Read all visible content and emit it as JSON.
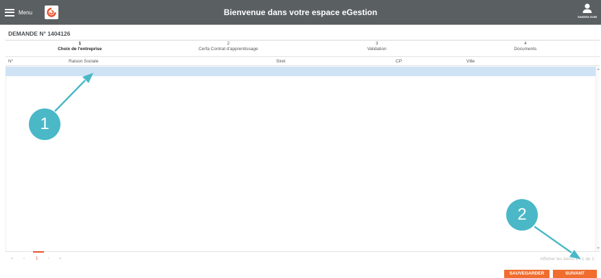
{
  "topbar": {
    "menu_label": "Menu",
    "title": "Bienvenue dans votre espace eGestion",
    "user_name": "SANDRA GUIB"
  },
  "demande": {
    "title": "DEMANDE N° 1404126"
  },
  "steps": [
    {
      "num": "1",
      "label": "Choix de l'entreprise",
      "active": true
    },
    {
      "num": "2",
      "label": "Cerfa Contrat d'apprentissage",
      "active": false
    },
    {
      "num": "3",
      "label": "Validation",
      "active": false
    },
    {
      "num": "4",
      "label": "Documents",
      "active": false
    }
  ],
  "table": {
    "columns": [
      "N°",
      "Raison Sociale",
      "Siret",
      "CP",
      "Ville"
    ]
  },
  "pager": {
    "first": "«",
    "prev": "‹",
    "current_page": "1",
    "next": "›",
    "last": "»",
    "info": "Afficher les items 1 - 1 de 1"
  },
  "buttons": {
    "save": "SAUVEGARDER",
    "next": "SUIVANT"
  },
  "annotations": [
    {
      "label": "1"
    },
    {
      "label": "2"
    }
  ],
  "colors": {
    "topbar": "#5a5f61",
    "accent": "#f06d2e",
    "selection": "#cfe3f5",
    "annotation": "#4ab8c7"
  }
}
